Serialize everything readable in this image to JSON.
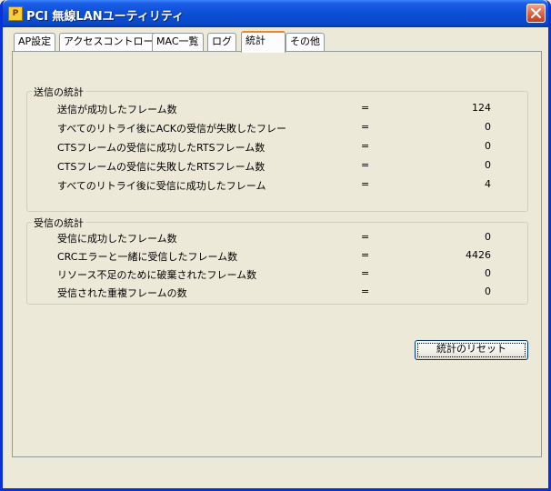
{
  "window": {
    "title": "PCI 無線LANユーティリティ",
    "app_icon": "wlan-utility-icon",
    "close_icon": "close-icon"
  },
  "tabs": [
    {
      "label": "AP設定",
      "active": false
    },
    {
      "label": "アクセスコントロール",
      "active": false
    },
    {
      "label": "MAC一覧",
      "active": false
    },
    {
      "label": "ログ",
      "active": false
    },
    {
      "label": "統計",
      "active": true
    },
    {
      "label": "その他",
      "active": false
    }
  ],
  "send_stats": {
    "title": "送信の統計",
    "rows": [
      {
        "label": "送信が成功したフレーム数",
        "eq": "=",
        "value": "124"
      },
      {
        "label": "すべてのリトライ後にACKの受信が失敗したフレー",
        "eq": "=",
        "value": "0"
      },
      {
        "label": "CTSフレームの受信に成功したRTSフレーム数",
        "eq": "=",
        "value": "0"
      },
      {
        "label": "CTSフレームの受信に失敗したRTSフレーム数",
        "eq": "=",
        "value": "0"
      },
      {
        "label": "すべてのリトライ後に受信に成功したフレーム",
        "eq": "=",
        "value": "4"
      }
    ]
  },
  "recv_stats": {
    "title": "受信の統計",
    "rows": [
      {
        "label": "受信に成功したフレーム数",
        "eq": "=",
        "value": "0"
      },
      {
        "label": "CRCエラーと一緒に受信したフレーム数",
        "eq": "=",
        "value": "4426"
      },
      {
        "label": "リソース不足のために破棄されたフレーム数",
        "eq": "=",
        "value": "0"
      },
      {
        "label": "受信された重複フレームの数",
        "eq": "=",
        "value": "0"
      }
    ]
  },
  "reset_button": {
    "label": "統計のリセット"
  },
  "colors": {
    "titlebar": "#0b4fd6",
    "window_bg": "#ece9d8",
    "active_tab_accent": "#e68b2c",
    "close_button": "#e36a45"
  }
}
